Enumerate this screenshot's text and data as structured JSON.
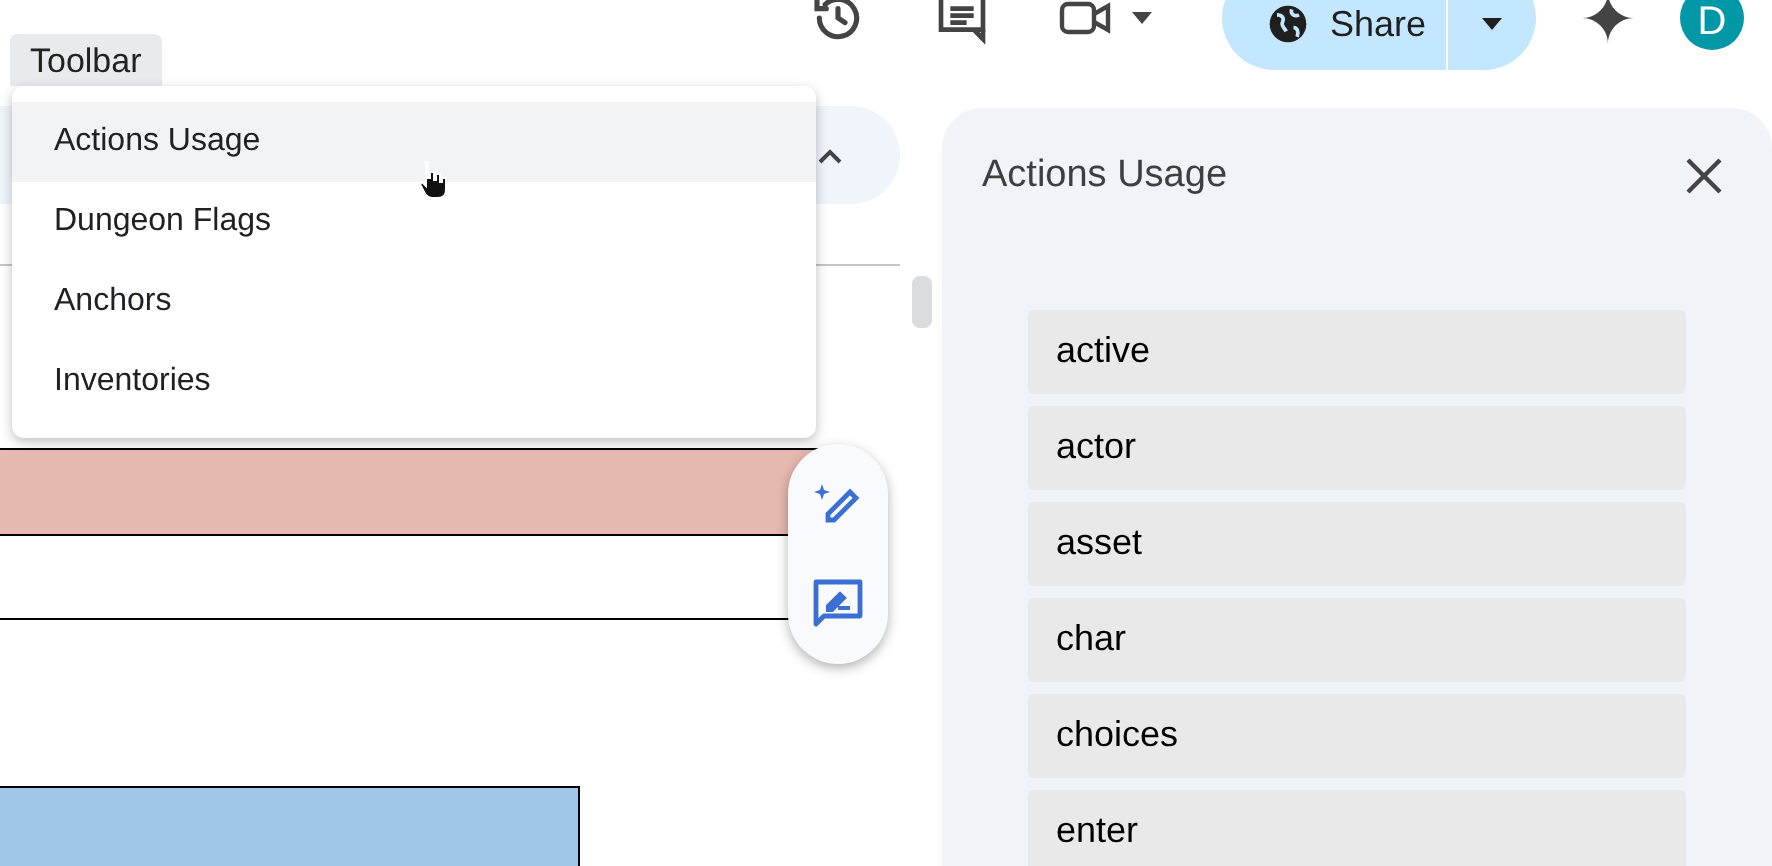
{
  "toolbar_menu": {
    "label": "Toolbar",
    "items": [
      {
        "label": "Actions Usage",
        "selected": true
      },
      {
        "label": "Dungeon Flags",
        "selected": false
      },
      {
        "label": "Anchors",
        "selected": false
      },
      {
        "label": "Inventories",
        "selected": false
      }
    ]
  },
  "share_button": {
    "label": "Share"
  },
  "account": {
    "initial": "D"
  },
  "side_panel": {
    "title": "Actions Usage",
    "items": [
      "active",
      "actor",
      "asset",
      "char",
      "choices",
      "enter"
    ]
  }
}
